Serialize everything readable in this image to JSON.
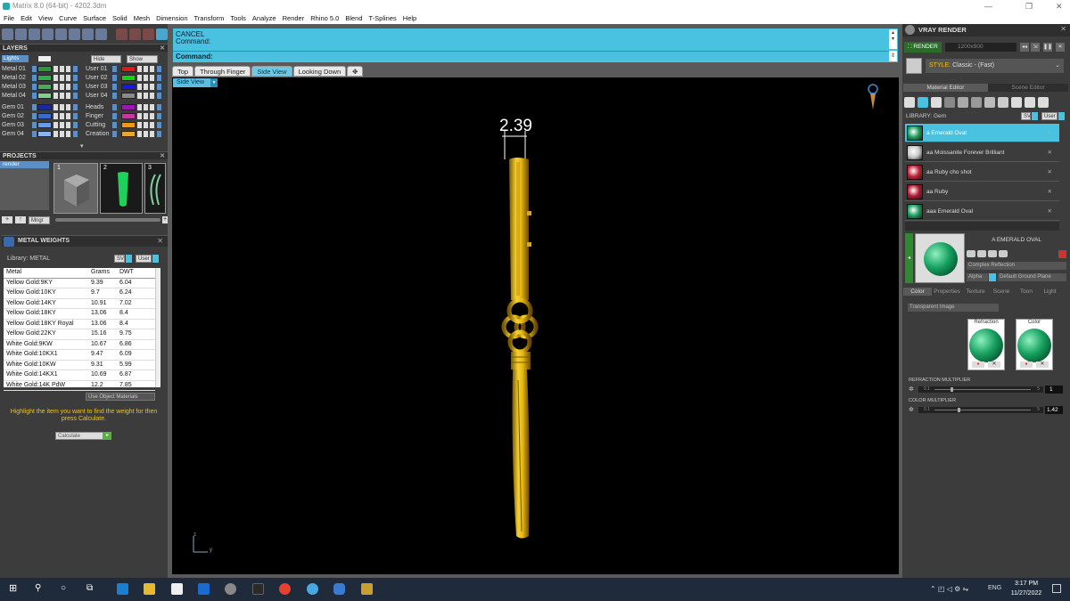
{
  "window": {
    "title": "Matrix 8.0 (64-bit) - 4202.3dm",
    "minimize_glyph": "—",
    "maximize_glyph": "❐",
    "close_glyph": "✕"
  },
  "menu": [
    "File",
    "Edit",
    "View",
    "Curve",
    "Surface",
    "Solid",
    "Mesh",
    "Dimension",
    "Transform",
    "Tools",
    "Analyze",
    "Render",
    "Rhino 5.0",
    "Blend",
    "T-Splines",
    "Help"
  ],
  "layers": {
    "header": "LAYERS",
    "lights_label": "Lights",
    "hide_label": "Hide",
    "show_label": "Show",
    "left": [
      {
        "name": "Metal 01",
        "color": "#2a9a3a"
      },
      {
        "name": "Metal 02",
        "color": "#2fb04a"
      },
      {
        "name": "Metal 03",
        "color": "#4aaa5a"
      },
      {
        "name": "Metal 04",
        "color": "#7fd08a"
      },
      {
        "name": "Gem 01",
        "color": "#1a2a9a"
      },
      {
        "name": "Gem 02",
        "color": "#3a6ad0"
      },
      {
        "name": "Gem 03",
        "color": "#6a9ae8"
      },
      {
        "name": "Gem 04",
        "color": "#8ab4f0"
      }
    ],
    "right": [
      {
        "name": "User 01",
        "color": "#e01818"
      },
      {
        "name": "User 02",
        "color": "#18d018"
      },
      {
        "name": "User 03",
        "color": "#1818e0"
      },
      {
        "name": "User 04",
        "color": "#8a8a8a"
      },
      {
        "name": "Heads",
        "color": "#9a1ab0"
      },
      {
        "name": "Finger",
        "color": "#c03aa0"
      },
      {
        "name": "Cutting",
        "color": "#e89a18"
      },
      {
        "name": "Creation",
        "color": "#e8a830"
      }
    ]
  },
  "projects": {
    "header": "PROJECTS",
    "item": "render",
    "thumb_numbers": [
      "1",
      "2",
      "3"
    ],
    "mngr_label": "Mngr"
  },
  "metal_weights": {
    "header": "METAL WEIGHTS",
    "library_label": "Library: METAL",
    "sv_label": "SV",
    "user_label": "User",
    "columns": [
      "Metal",
      "Grams",
      "DWT"
    ],
    "rows": [
      [
        "Yellow Gold:9KY",
        "9.39",
        "6.04"
      ],
      [
        "Yellow Gold:10KY",
        "9.7",
        "6.24"
      ],
      [
        "Yellow Gold:14KY",
        "10.91",
        "7.02"
      ],
      [
        "Yellow Gold:18KY",
        "13.06",
        "8.4"
      ],
      [
        "Yellow Gold:18KY Royal",
        "13.06",
        "8.4"
      ],
      [
        "Yellow Gold:22KY",
        "15.16",
        "9.75"
      ],
      [
        "White Gold:9KW",
        "10.67",
        "6.86"
      ],
      [
        "White Gold:10KX1",
        "9.47",
        "6.09"
      ],
      [
        "White Gold:10KW",
        "9.31",
        "5.99"
      ],
      [
        "White Gold:14KX1",
        "10.69",
        "6.87"
      ],
      [
        "White Gold:14K PdW",
        "12.2",
        "7.85"
      ]
    ],
    "use_object_materials": "Use Object Materials",
    "hint": "Highlight the item you want to find the weight for then press Calculate.",
    "calculate_label": "Calculate"
  },
  "command": {
    "cancel": "CANCEL",
    "prompt1": "Command:",
    "prompt2": "Command:"
  },
  "view_tabs": [
    {
      "label": "Top",
      "active": false
    },
    {
      "label": "Through Finger",
      "active": false
    },
    {
      "label": "Side View",
      "active": true
    },
    {
      "label": "Looking Down",
      "active": false
    },
    {
      "label": "✥",
      "active": false
    }
  ],
  "viewport": {
    "name": "Side View",
    "dimension": "2.39",
    "axis_z": "z",
    "axis_y": "y"
  },
  "vray": {
    "header": "VRAY RENDER",
    "render_label": "RENDER",
    "resolution": "1200x900",
    "style_label": "STYLE:",
    "style_value": "Classic - (Fast)",
    "tabs": [
      "Material Editor",
      "Scene Editor"
    ],
    "library_label": "LIBRARY: Gem",
    "sv_label": "SV",
    "user_label": "User",
    "materials": [
      {
        "name": "a Emerald Oval",
        "color": "#1a9a5a",
        "selected": true
      },
      {
        "name": "aa Moissanite Forever Brilliant",
        "color": "#c8c8c8",
        "selected": false
      },
      {
        "name": "aa Ruby cho shot",
        "color": "#c02030",
        "selected": false
      },
      {
        "name": "aa Ruby",
        "color": "#b01830",
        "selected": false
      },
      {
        "name": "aaa Emerald Oval",
        "color": "#1a9a5a",
        "selected": false
      }
    ],
    "preview_title": "A EMERALD OVAL",
    "complex_reflection": "Complex Reflection",
    "alpha_label": "Alpha",
    "ground_plane": "Default Ground Plane",
    "sub_tabs": [
      "Color",
      "Properties",
      "Texture",
      "Scene",
      "Toon",
      "Light"
    ],
    "transparent_image": "Transparent Image",
    "refraction_label": "Refraction",
    "color_label": "Color",
    "refraction_multiplier": {
      "label": "REFRACTION MULTIPLIER",
      "min": "0.1",
      "max": "5",
      "value": "1"
    },
    "color_multiplier": {
      "label": "COLOR MULTIPLIER",
      "min": "0.1",
      "max": "5",
      "value": "1.42"
    }
  },
  "taskbar": {
    "lang": "ENG",
    "time": "3:17 PM",
    "date": "11/27/2022"
  }
}
